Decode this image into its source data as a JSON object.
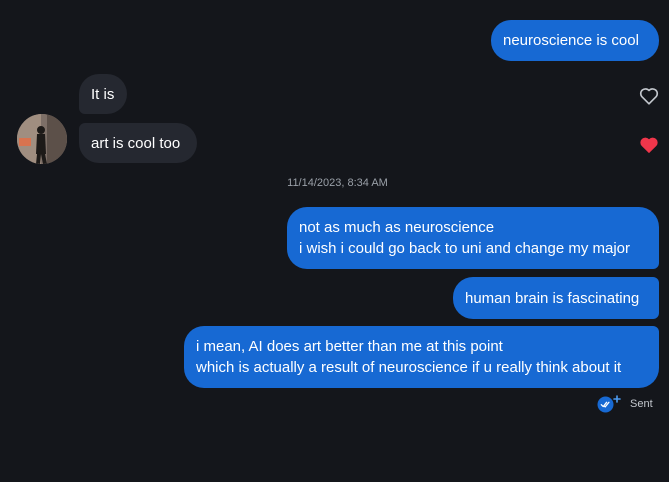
{
  "chat": {
    "timestamp": "11/14/2023, 8:34 AM",
    "status": "Sent",
    "messages": [
      {
        "lines": [
          "neuroscience is cool"
        ]
      },
      {
        "lines": [
          "It is"
        ]
      },
      {
        "lines": [
          "art is cool too"
        ]
      },
      {
        "lines": [
          "not as much as neuroscience",
          "i wish i could go back to uni and change my major"
        ]
      },
      {
        "lines": [
          "human brain is fascinating"
        ]
      },
      {
        "lines": [
          "i mean, AI does art better than me at this point",
          "which is actually a result of neuroscience if u really think about it"
        ]
      }
    ]
  },
  "icons": {
    "heart_outline": "heart-outline-icon",
    "heart_filled": "heart-filled-icon",
    "read_receipt": "double-check-icon"
  },
  "colors": {
    "background": "#14161b",
    "outgoing_bubble": "#1769d3",
    "incoming_bubble": "#252830",
    "like_red": "#f0364b"
  }
}
